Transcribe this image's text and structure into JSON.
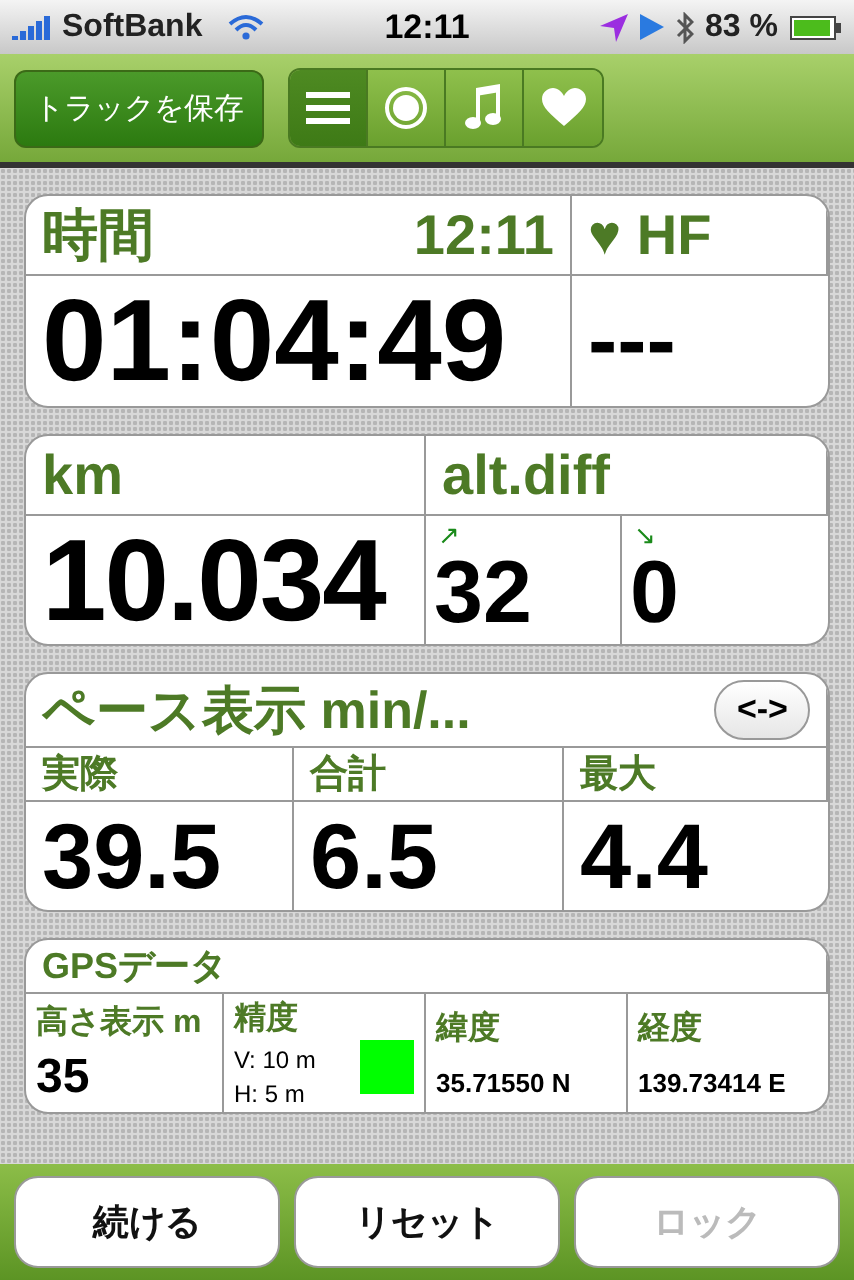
{
  "status_bar": {
    "carrier": "SoftBank",
    "time": "12:11",
    "battery": "83 %"
  },
  "toolbar": {
    "save_button": "トラックを保存",
    "segments": [
      {
        "kind": "list",
        "selected": true
      },
      {
        "kind": "record",
        "selected": false
      },
      {
        "kind": "music",
        "selected": false
      },
      {
        "kind": "heart",
        "selected": false
      }
    ]
  },
  "time_card": {
    "label": "時間",
    "clock": "12:11",
    "value": "01:04:49",
    "hr_label": "♥ HF",
    "hr_value": "---"
  },
  "distance_card": {
    "label": "km",
    "value": "10.034",
    "alt_label": "alt.diff",
    "ascent_arrow": "↗",
    "ascent": "32",
    "descent_arrow": "↘",
    "descent": "0"
  },
  "pace_card": {
    "title": "ペース表示 min/...",
    "toggle": "<->",
    "cells": [
      {
        "label": "実際",
        "value": "39.5"
      },
      {
        "label": "合計",
        "value": "6.5"
      },
      {
        "label": "最大",
        "value": "4.4"
      }
    ]
  },
  "gps_card": {
    "title": "GPSデータ",
    "altitude_label": "高さ表示 m",
    "altitude": "35",
    "accuracy_label": "精度",
    "accuracy_v": "V: 10 m",
    "accuracy_h": "H: 5 m",
    "signal": {
      "color": "#00ff00"
    },
    "lat_label": "緯度",
    "lat": "35.71550 N",
    "lon_label": "経度",
    "lon": "139.73414 E"
  },
  "bottom_buttons": [
    {
      "label": "続ける",
      "disabled": false
    },
    {
      "label": "リセット",
      "disabled": false
    },
    {
      "label": "ロック",
      "disabled": true
    }
  ]
}
